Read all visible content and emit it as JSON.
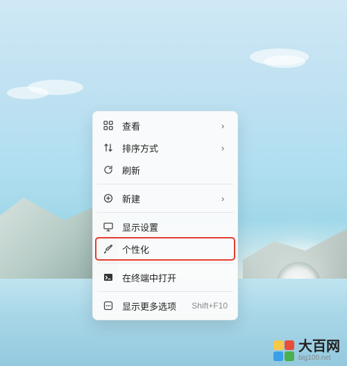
{
  "contextMenu": {
    "items": [
      {
        "icon": "grid-icon",
        "label": "查看",
        "submenu": true
      },
      {
        "icon": "sort-icon",
        "label": "排序方式",
        "submenu": true
      },
      {
        "icon": "refresh-icon",
        "label": "刷新",
        "submenu": false
      },
      {
        "sep": true
      },
      {
        "icon": "plus-circle-icon",
        "label": "新建",
        "submenu": true
      },
      {
        "sep": true
      },
      {
        "icon": "display-icon",
        "label": "显示设置",
        "submenu": false
      },
      {
        "icon": "brush-icon",
        "label": "个性化",
        "submenu": false,
        "highlight": true
      },
      {
        "sep": true
      },
      {
        "icon": "terminal-icon",
        "label": "在终端中打开",
        "submenu": false
      },
      {
        "sep": true
      },
      {
        "icon": "more-icon",
        "label": "显示更多选项",
        "submenu": false,
        "shortcut": "Shift+F10"
      }
    ]
  },
  "brand": {
    "name_cn": "大百网",
    "name_en": "big100.net"
  },
  "colors": {
    "highlight_outline": "#e33b2e"
  }
}
